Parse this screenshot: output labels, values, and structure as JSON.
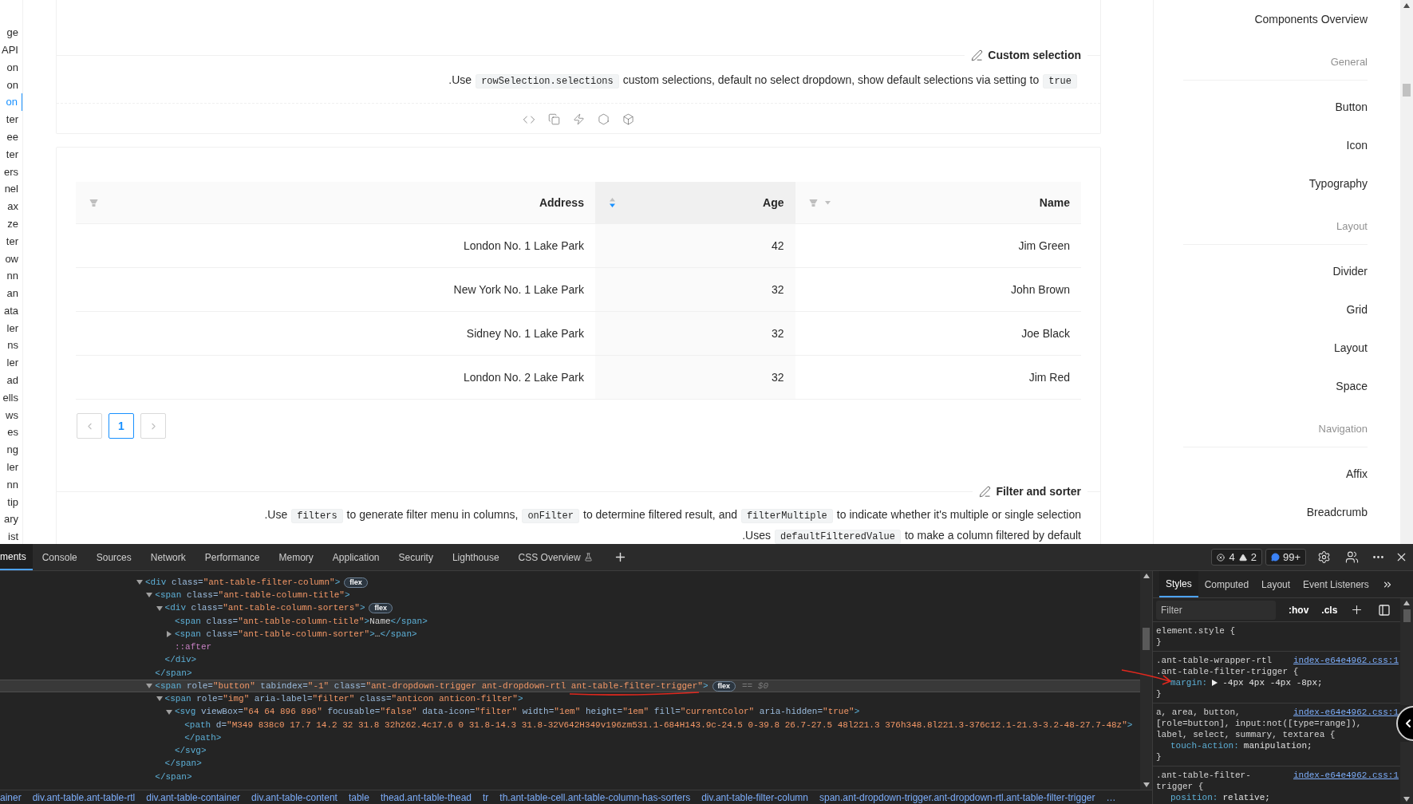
{
  "left_nav": [
    {
      "label": "ge",
      "selected": false
    },
    {
      "label": "API",
      "selected": false
    },
    {
      "label": "on",
      "selected": false
    },
    {
      "label": "on",
      "selected": false
    },
    {
      "label": "on",
      "selected": true
    },
    {
      "label": "ter",
      "selected": false
    },
    {
      "label": "ee",
      "selected": false
    },
    {
      "label": "ter",
      "selected": false
    },
    {
      "label": "ers",
      "selected": false
    },
    {
      "label": "nel",
      "selected": false
    },
    {
      "label": "ax",
      "selected": false
    },
    {
      "label": "ze",
      "selected": false
    },
    {
      "label": "ter",
      "selected": false
    },
    {
      "label": "ow",
      "selected": false
    },
    {
      "label": "nn",
      "selected": false
    },
    {
      "label": "an",
      "selected": false
    },
    {
      "label": "ata",
      "selected": false
    },
    {
      "label": "ler",
      "selected": false
    },
    {
      "label": "ns",
      "selected": false
    },
    {
      "label": "ler",
      "selected": false
    },
    {
      "label": "ad",
      "selected": false
    },
    {
      "label": "ells",
      "selected": false
    },
    {
      "label": "ws",
      "selected": false
    },
    {
      "label": "es",
      "selected": false
    },
    {
      "label": "ng",
      "selected": false
    },
    {
      "label": "ler",
      "selected": false
    },
    {
      "label": "nn",
      "selected": false
    },
    {
      "label": "tip",
      "selected": false
    },
    {
      "label": "ary",
      "selected": false
    },
    {
      "label": "ist",
      "selected": false
    }
  ],
  "custom_selection": {
    "title": "Custom selection",
    "description": [
      {
        "kind": "text",
        "text": ".Use"
      },
      {
        "kind": "code",
        "text": "rowSelection.selections"
      },
      {
        "kind": "text",
        "text": "custom selections, default no select dropdown, show default selections via setting to"
      },
      {
        "kind": "code",
        "text": "true"
      }
    ]
  },
  "table": {
    "columns": [
      {
        "title": "Address",
        "filter": true,
        "sort_up": false,
        "sort_down": false,
        "sorted": false
      },
      {
        "title": "Age",
        "filter": false,
        "sort_up": true,
        "sort_down": true,
        "sorted": true
      },
      {
        "title": "Name",
        "filter": true,
        "sort_up": false,
        "sort_down": true,
        "sorted": false
      }
    ],
    "rows": [
      {
        "cells": [
          "London No. 1 Lake Park",
          "42",
          "Jim Green"
        ]
      },
      {
        "cells": [
          "New York No. 1 Lake Park",
          "32",
          "John Brown"
        ]
      },
      {
        "cells": [
          "Sidney No. 1 Lake Park",
          "32",
          "Joe Black"
        ]
      },
      {
        "cells": [
          "London No. 2 Lake Park",
          "32",
          "Jim Red"
        ]
      }
    ]
  },
  "pagination": {
    "prev_disabled": true,
    "next_disabled": true,
    "pages": [
      {
        "label": "1",
        "selected": true
      }
    ]
  },
  "filter_and_sorter": {
    "title": "Filter and sorter",
    "description_lines": [
      [
        {
          "kind": "text",
          "text": ".Use"
        },
        {
          "kind": "code",
          "text": "filters"
        },
        {
          "kind": "text",
          "text": "to generate filter menu in columns,"
        },
        {
          "kind": "code",
          "text": "onFilter"
        },
        {
          "kind": "text",
          "text": "to determine filtered result, and"
        },
        {
          "kind": "code",
          "text": "filterMultiple"
        },
        {
          "kind": "text",
          "text": "to indicate whether it's multiple or single selection"
        }
      ],
      [
        {
          "kind": "text",
          "text": ".Uses"
        },
        {
          "kind": "code",
          "text": "defaultFilteredValue"
        },
        {
          "kind": "text",
          "text": "to make a column filtered by default"
        }
      ]
    ]
  },
  "side_menu": [
    {
      "kind": "item",
      "label": "Components Overview",
      "selected": false
    },
    {
      "kind": "group",
      "label": "General"
    },
    {
      "kind": "item",
      "label": "Button",
      "selected": false
    },
    {
      "kind": "item",
      "label": "Icon",
      "selected": false
    },
    {
      "kind": "item",
      "label": "Typography",
      "selected": false
    },
    {
      "kind": "group",
      "label": "Layout"
    },
    {
      "kind": "item",
      "label": "Divider",
      "selected": false
    },
    {
      "kind": "item",
      "label": "Grid",
      "selected": false
    },
    {
      "kind": "item",
      "label": "Layout",
      "selected": false
    },
    {
      "kind": "item",
      "label": "Space",
      "selected": false
    },
    {
      "kind": "group",
      "label": "Navigation"
    },
    {
      "kind": "item",
      "label": "Affix",
      "selected": false
    },
    {
      "kind": "item",
      "label": "Breadcrumb",
      "selected": false
    }
  ],
  "devtools": {
    "tabs": [
      {
        "label": "ments",
        "selected": true,
        "experimental": false
      },
      {
        "label": "Console",
        "selected": false,
        "experimental": false
      },
      {
        "label": "Sources",
        "selected": false,
        "experimental": false
      },
      {
        "label": "Network",
        "selected": false,
        "experimental": false
      },
      {
        "label": "Performance",
        "selected": false,
        "experimental": false
      },
      {
        "label": "Memory",
        "selected": false,
        "experimental": false
      },
      {
        "label": "Application",
        "selected": false,
        "experimental": false
      },
      {
        "label": "Security",
        "selected": false,
        "experimental": false
      },
      {
        "label": "Lighthouse",
        "selected": false,
        "experimental": false
      },
      {
        "label": "CSS Overview",
        "selected": false,
        "experimental": true
      }
    ],
    "errors": "4",
    "warnings": "2",
    "messages": "99+",
    "elements_tree": [
      {
        "kind": "element",
        "open": "<div class=\"ant-table-filter-column\">",
        "expanded": true,
        "badge": "flex",
        "selected": false,
        "children": [
          {
            "kind": "element",
            "open": "<span class=\"ant-table-column-title\">",
            "expanded": true,
            "selected": false,
            "children": [
              {
                "kind": "element",
                "open": "<div class=\"ant-table-column-sorters\">",
                "expanded": true,
                "badge": "flex",
                "selected": false,
                "children": [
                  {
                    "kind": "leaf",
                    "open": "<span class=\"ant-table-column-title\">Name</span>",
                    "selected": false
                  },
                  {
                    "kind": "element",
                    "open": "<span class=\"ant-table-column-sorter\">…</span>",
                    "expanded": false,
                    "selected": false
                  },
                  {
                    "kind": "pseudo",
                    "open": "::after",
                    "selected": false
                  }
                ],
                "close": "</div>"
              }
            ],
            "close": "</span>"
          },
          {
            "kind": "element",
            "open": "<span role=\"button\" tabindex=\"-1\" class=\"ant-dropdown-trigger ant-dropdown-rtl ant-table-filter-trigger\">",
            "expanded": true,
            "badge": "flex",
            "note": "== $0",
            "selected": true,
            "children": [
              {
                "kind": "element",
                "open": "<span role=\"img\" aria-label=\"filter\" class=\"anticon anticon-filter\">",
                "expanded": true,
                "selected": false,
                "children": [
                  {
                    "kind": "element",
                    "open": "<svg viewBox=\"64 64 896 896\" focusable=\"false\" data-icon=\"filter\" width=\"1em\" height=\"1em\" fill=\"currentColor\" aria-hidden=\"true\">",
                    "expanded": true,
                    "selected": false,
                    "children": [
                      {
                        "kind": "leaf",
                        "open": "<path d=\"M349 838c0 17.7 14.2 32 31.8 32h262.4c17.6 0 31.8-14.3 31.8-32V642H349v196zm531.1-684H143.9c-24.5 0-39.8 26.7-27.5 48l221.3 376h348.8l221.3-376c12.1-21.3-3.2-48-27.7-48z\">",
                        "close": "</path>",
                        "selected": false
                      }
                    ],
                    "close": "</svg>"
                  }
                ],
                "close": "</span>"
              }
            ],
            "close": "</span>"
          }
        ]
      }
    ],
    "breadcrumbs": [
      "ainer",
      "div.ant-table.ant-table-rtl",
      "div.ant-table-container",
      "div.ant-table-content",
      "table",
      "thead.ant-table-thead",
      "tr",
      "th.ant-table-cell.ant-table-column-has-sorters",
      "div.ant-table-filter-column",
      "span.ant-dropdown-trigger.ant-dropdown-rtl.ant-table-filter-trigger",
      "…"
    ],
    "styles_tabs": [
      {
        "label": "Styles",
        "selected": true
      },
      {
        "label": "Computed",
        "selected": false
      },
      {
        "label": "Layout",
        "selected": false
      },
      {
        "label": "Event Listeners",
        "selected": false
      }
    ],
    "filter": {
      "placeholder": "Filter"
    },
    "style_toggles": [
      ":hov",
      ".cls"
    ],
    "rules": [
      {
        "selector": [
          "element.style {"
        ],
        "close": "}"
      },
      {
        "selector": [
          ".ant-table-wrapper-rtl",
          ".ant-table-filter-trigger {"
        ],
        "source": "index-e64e4962.css:1",
        "declarations": [
          {
            "property": "margin:",
            "value": "-4px 4px -4px -8px;",
            "shorthand": true
          }
        ],
        "close": "}"
      },
      {
        "selector": [
          "a, area, button,",
          "[role=button], input:not([type=range]),",
          "label, select, summary, textarea {"
        ],
        "source": "index-e64e4962.css:1",
        "declarations": [
          {
            "property": "touch-action:",
            "value": "manipulation;",
            "shorthand": false
          }
        ],
        "close": "}"
      },
      {
        "selector": [
          ".ant-table-filter-",
          "trigger {"
        ],
        "source": "index-e64e4962.css:1",
        "declarations": [
          {
            "property": "position:",
            "value": "relative;",
            "shorthand": false
          }
        ]
      }
    ]
  }
}
